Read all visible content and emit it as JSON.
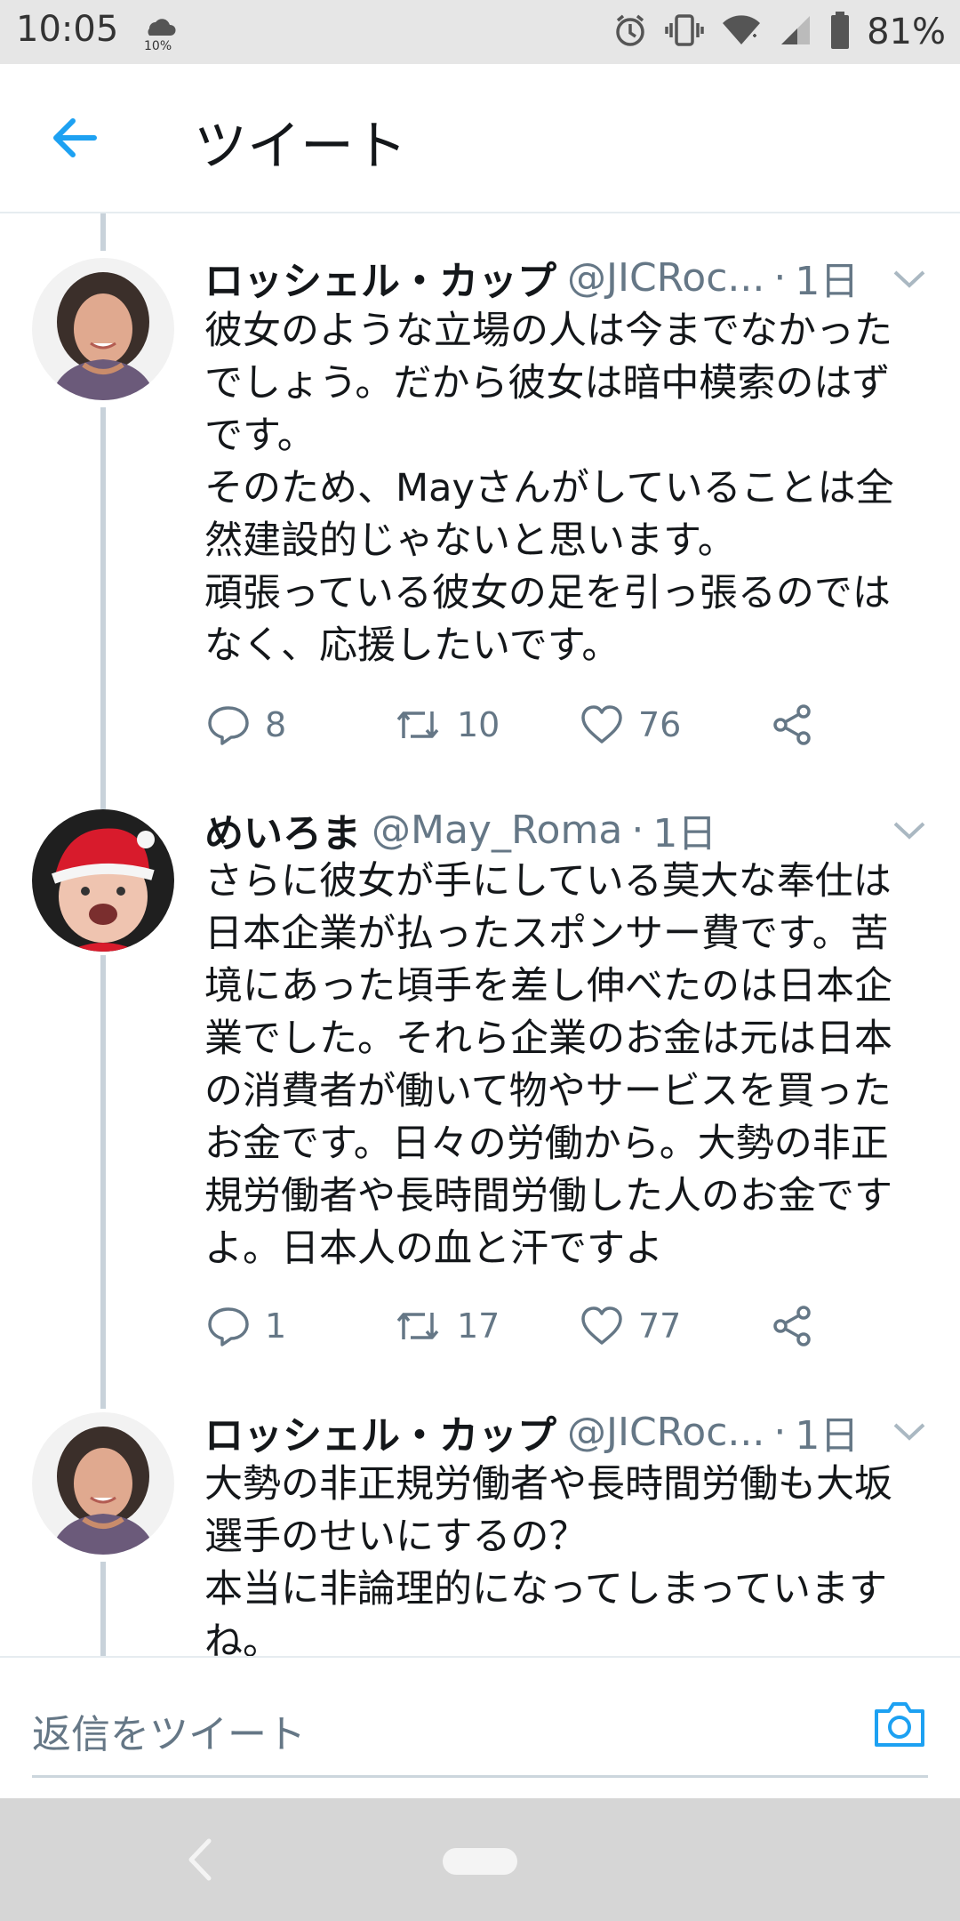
{
  "status_bar": {
    "time": "10:05",
    "weather_percent": "10%",
    "battery_percent": "81%",
    "icons": [
      "cloud-icon",
      "alarm-icon",
      "vibrate-icon",
      "wifi-icon",
      "signal-icon",
      "battery-icon"
    ]
  },
  "header": {
    "title": "ツイート",
    "back_icon": "arrow-left-icon"
  },
  "colors": {
    "accent": "#1da1f2",
    "secondary_text": "#657786",
    "thread_line": "#c8d2da"
  },
  "tweets": [
    {
      "name": "ロッシェル・カップ",
      "handle": "@JICRoc...",
      "separator": "·",
      "time": "1日",
      "lines": [
        "彼女のような立場の人は今までなかった",
        "でしょう。だから彼女は暗中模索のはず",
        "です。",
        "そのため、Mayさんがしていることは全",
        "然建設的じゃないと思います。",
        "頑張っている彼女の足を引っ張るのでは",
        "なく、応援したいです。"
      ],
      "replies": "8",
      "retweets": "10",
      "likes": "76"
    },
    {
      "name": "めいろま",
      "handle": "@May_Roma",
      "separator": "·",
      "time": "1日",
      "lines": [
        "さらに彼女が手にしている莫大な奉仕は",
        "日本企業が払ったスポンサー費です。苦",
        "境にあった頃手を差し伸べたのは日本企",
        "業でした。それら企業のお金は元は日本",
        "の消費者が働いて物やサービスを買った",
        "お金です。日々の労働から。大勢の非正",
        "規労働者や長時間労働した人のお金です",
        "よ。日本人の血と汗ですよ"
      ],
      "replies": "1",
      "retweets": "17",
      "likes": "77"
    },
    {
      "name": "ロッシェル・カップ",
      "handle": "@JICRoc...",
      "separator": "·",
      "time": "1日",
      "lines": [
        "大勢の非正規労働者や長時間労働も大坂",
        "選手のせいにするの？",
        "本当に非論理的になってしまっています",
        "ね。"
      ]
    }
  ],
  "reply_bar": {
    "placeholder": "返信をツイート",
    "camera_icon": "camera-icon"
  },
  "nav_bar": {
    "back_icon": "nav-back-icon",
    "home_icon": "home-pill-icon"
  }
}
